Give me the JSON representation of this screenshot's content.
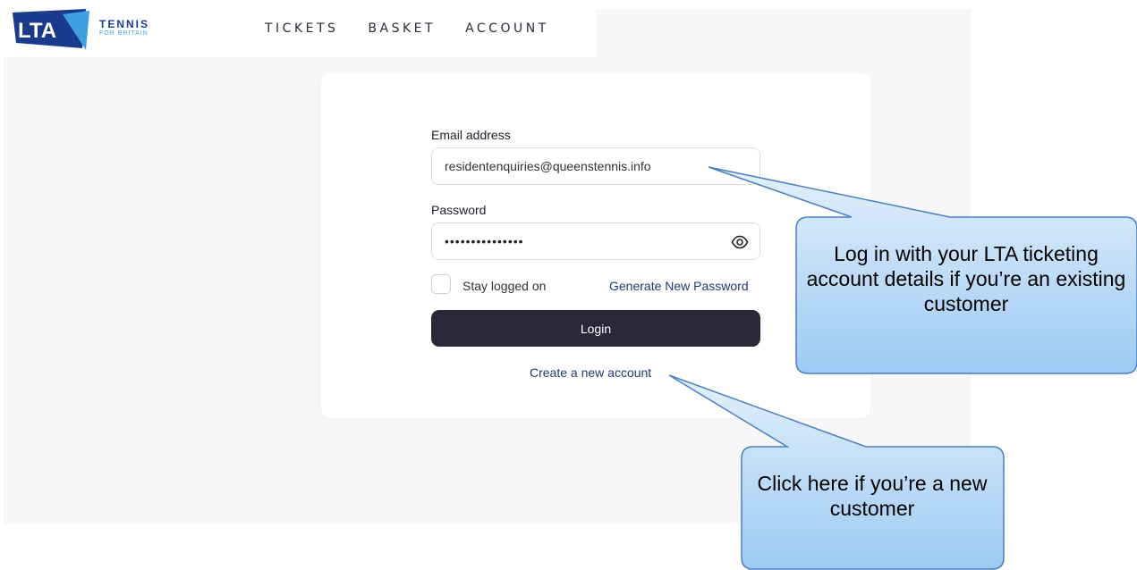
{
  "brand": {
    "logo_text": "LTA",
    "word": "TENNIS",
    "sub": "FOR BRITAIN",
    "colors": {
      "navy": "#1a3a8c",
      "light_blue": "#3ea0e0"
    }
  },
  "nav": {
    "items": [
      {
        "label": "TICKETS"
      },
      {
        "label": "BASKET"
      },
      {
        "label": "ACCOUNT"
      }
    ]
  },
  "login": {
    "email_label": "Email address",
    "email_value": "residentenquiries@queenstennis.info",
    "password_label": "Password",
    "password_masked": "•••••••••••••••",
    "stay_logged_label": "Stay logged on",
    "generate_password_label": "Generate New Password",
    "login_button_label": "Login",
    "create_account_label": "Create a new account",
    "icons": {
      "password_toggle": "eye-icon"
    },
    "colors": {
      "button": "#2b2738",
      "link": "#1e3a6e"
    }
  },
  "callouts": {
    "existing": "Log in with your LTA ticketing account details if you’re an existing customer",
    "new": "Click here if you’re a new customer",
    "colors": {
      "fill_top": "#e4f0fb",
      "fill_bottom": "#9ccaf3",
      "border": "#4a7fc0"
    }
  }
}
